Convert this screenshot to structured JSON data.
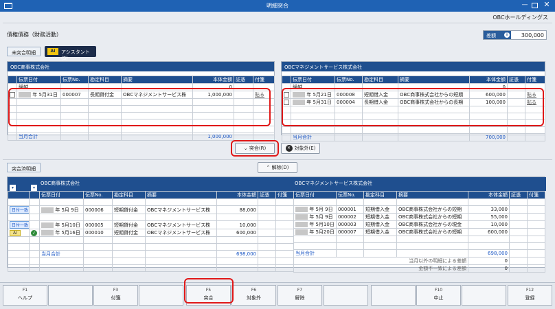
{
  "window": {
    "title": "明細突合"
  },
  "company": "OBCホールディングス",
  "page_title": "債権債務（財務活動）",
  "diff": {
    "label": "差額",
    "value": "300,000"
  },
  "tabs": {
    "unmatched": "未突合明細",
    "assistant": "アシスタント(S)",
    "matched": "突合済明細"
  },
  "left_panel": {
    "title": "OBC商事株式会社",
    "headers": [
      "伝票日付",
      "伝票No.",
      "勘定科目",
      "摘要",
      "本体金額",
      "証憑",
      "付箋"
    ],
    "carry": {
      "label": "繰越",
      "value": "0"
    },
    "rows": [
      {
        "date": "年  5月31日",
        "no": "000007",
        "account": "長期貸付金",
        "memo": "OBCマネジメントサービス株",
        "amount": "1,000,000",
        "attach": "貼る"
      }
    ],
    "total_label": "当月合計",
    "total": "1,000,000"
  },
  "right_panel": {
    "title": "OBCマネジメントサービス株式会社",
    "headers": [
      "伝票日付",
      "伝票No.",
      "勘定科目",
      "摘要",
      "本体金額",
      "証憑",
      "付箋"
    ],
    "carry": {
      "label": "繰越",
      "value": "0"
    },
    "rows": [
      {
        "date": "年  5月21日",
        "no": "000008",
        "account": "短期借入金",
        "memo": "OBC商事株式会社からの短期",
        "amount": "600,000",
        "attach": "貼る"
      },
      {
        "date": "年  5月31日",
        "no": "000004",
        "account": "長期借入金",
        "memo": "OBC商事株式会社からの長期",
        "amount": "100,000",
        "attach": "貼る"
      }
    ],
    "total_label": "当月合計",
    "total": "700,000"
  },
  "buttons": {
    "match": "突合(R)",
    "exclude": "対象外(E)",
    "unmatch": "解除(D)"
  },
  "matched": {
    "left_title": "OBC商事株式会社",
    "right_title": "OBCマネジメントサービス株式会社",
    "headers": [
      "伝票日付",
      "伝票No.",
      "勘定科目",
      "摘要",
      "本体金額",
      "証憑",
      "付箋"
    ],
    "rows": [
      {
        "badge": "日付一致",
        "date": "年  5月  9日",
        "no": "000006",
        "account": "短期貸付金",
        "memo": "OBCマネジメントサービス株",
        "amount": "88,000",
        "r_rows": [
          {
            "date": "年  5月  9日",
            "no": "000001",
            "account": "短期借入金",
            "memo": "OBC商事株式会社からの短期",
            "amount": "33,000"
          },
          {
            "date": "年  5月  9日",
            "no": "000002",
            "account": "短期借入金",
            "memo": "OBC商事株式会社からの短期",
            "amount": "55,000"
          }
        ]
      },
      {
        "badge": "日付一致",
        "date": "年  5月10日",
        "no": "000005",
        "account": "短期貸付金",
        "memo": "OBCマネジメントサービス株",
        "amount": "10,000",
        "r_rows": [
          {
            "date": "年  5月10日",
            "no": "000003",
            "account": "短期借入金",
            "memo": "OBC商事株式会社からの現金",
            "amount": "10,000"
          }
        ]
      },
      {
        "badge": "AI",
        "date": "年  5月16日",
        "no": "000010",
        "account": "短期貸付金",
        "memo": "OBCマネジメントサービス株",
        "amount": "600,000",
        "r_rows": [
          {
            "date": "年  5月20日",
            "no": "000007",
            "account": "短期借入金",
            "memo": "OBC商事株式会社からの短期",
            "amount": "600,000"
          }
        ]
      }
    ],
    "left_total_label": "当月合計",
    "left_total": "698,000",
    "right_total_label": "当月合計",
    "right_total": "698,000",
    "other_diff_label": "当月以外の明細による差額",
    "other_diff": "0",
    "amount_mismatch_label": "金額不一致による差額",
    "amount_mismatch": "0"
  },
  "fkeys": [
    {
      "key": "F1",
      "label": "ヘルプ"
    },
    {
      "key": "",
      "label": ""
    },
    {
      "key": "F3",
      "label": "付箋"
    },
    {
      "key": "",
      "label": ""
    },
    {
      "key": "F5",
      "label": "突合"
    },
    {
      "key": "F6",
      "label": "対象外"
    },
    {
      "key": "F7",
      "label": "解除"
    },
    {
      "key": "",
      "label": ""
    },
    {
      "key": "",
      "label": ""
    },
    {
      "key": "F10",
      "label": "中止"
    },
    {
      "key": "",
      "label": ""
    },
    {
      "key": "F12",
      "label": "登録"
    }
  ],
  "colors": {
    "title_bar": "#1f62b4",
    "header": "#1f4f8f",
    "highlight": "#e01818",
    "link": "#1a56c4"
  }
}
